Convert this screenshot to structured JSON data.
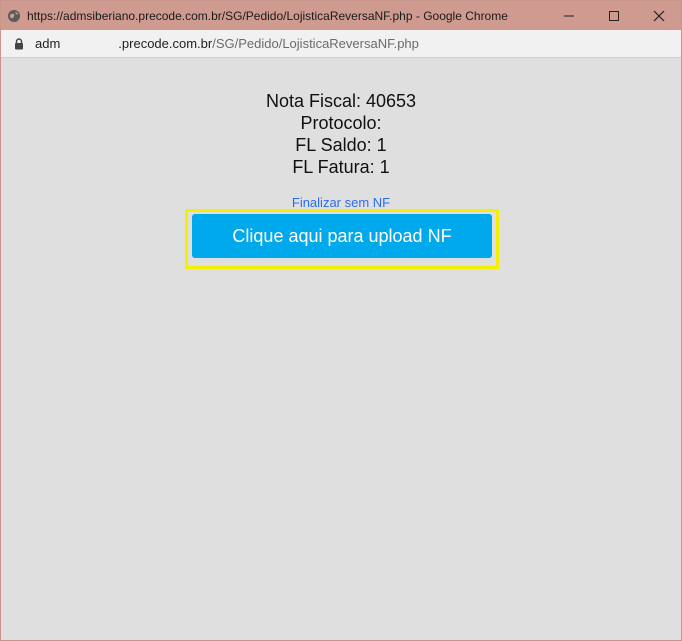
{
  "window": {
    "title": "https://admsiberiano.precode.com.br/SG/Pedido/LojisticaReversaNF.php - Google Chrome",
    "titlebar_color": "#cf9b90"
  },
  "address_bar": {
    "host_part_a": "adm",
    "host_part_b": ".precode.com.br",
    "path": "/SG/Pedido/LojisticaReversaNF.php"
  },
  "info": {
    "nota_fiscal": "Nota Fiscal: 40653",
    "protocolo": "Protocolo:",
    "fl_saldo": "FL Saldo: 1",
    "fl_fatura": "FL Fatura: 1"
  },
  "actions": {
    "finalizar_link": "Finalizar sem NF",
    "upload_button": "Clique aqui para upload NF",
    "upload_color": "#00a8ec",
    "highlight_color": "#f3f000"
  },
  "icons": {
    "site": "globe-icon",
    "lock": "lock-icon",
    "minimize": "minimize-icon",
    "maximize": "maximize-icon",
    "close": "close-icon"
  }
}
